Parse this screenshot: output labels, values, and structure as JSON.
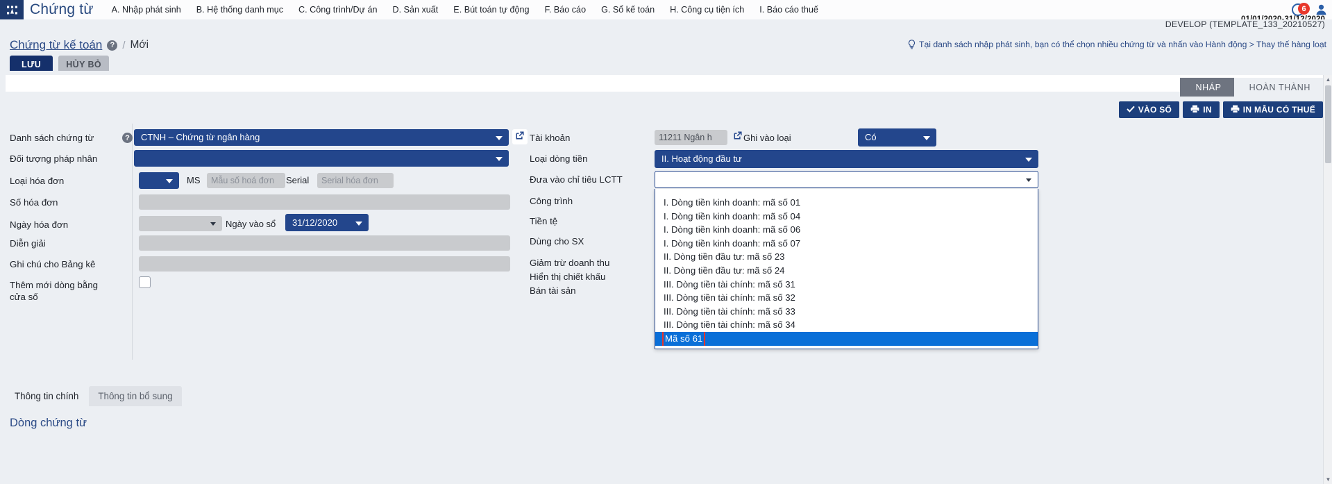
{
  "app": {
    "title": "Chứng từ",
    "logo_icon": "grid-app-icon"
  },
  "menu": [
    {
      "label": "A. Nhập phát sinh"
    },
    {
      "label": "B. Hệ thống danh mục"
    },
    {
      "label": "C. Công trình/Dự án"
    },
    {
      "label": "D. Sản xuất"
    },
    {
      "label": "E. Bút toán tự động"
    },
    {
      "label": "F. Báo cáo"
    },
    {
      "label": "G. Sổ kế toán"
    },
    {
      "label": "H. Công cụ tiện ích"
    },
    {
      "label": "I. Báo cáo thuế"
    }
  ],
  "topbar_right": {
    "notification_count": "6",
    "notification_icon": "bell-icon",
    "user_icon": "user-avatar-icon",
    "date_range": "01/01/2020-31/12/2020",
    "develop_label": "DEVELOP (TEMPLATE_133_20210527)"
  },
  "breadcrumb": {
    "link": "Chứng từ kế toán",
    "help_icon": "question-mark-icon",
    "separator": "/",
    "current": "Mới"
  },
  "tip": {
    "icon": "lightbulb-icon",
    "text": "Tại danh sách nhập phát sinh, bạn có thể chọn nhiều chứng từ và nhấn vào Hành động > Thay thế hàng loạt"
  },
  "actions": {
    "save_label": "LƯU",
    "cancel_label": "HỦY BỎ"
  },
  "status_tabs": [
    {
      "label": "NHÁP",
      "state": "active"
    },
    {
      "label": "HOÀN THÀNH",
      "state": "inactive"
    }
  ],
  "toolbar": [
    {
      "label": "VÀO SỔ",
      "icon": "check-icon"
    },
    {
      "label": "IN",
      "icon": "printer-icon"
    },
    {
      "label": "IN MẪU CÓ THUẾ",
      "icon": "printer-icon"
    }
  ],
  "form": {
    "left_column": [
      {
        "label": "Danh sách chứng từ",
        "help_icon": "question-mark-icon"
      },
      {
        "label": "Đối tượng pháp nhân"
      },
      {
        "label": "Loại hóa đơn"
      },
      {
        "label": "Số hóa đơn"
      },
      {
        "label": "Ngày hóa đơn"
      },
      {
        "label": "Diễn giải"
      },
      {
        "label": "Ghi chú cho Bảng kê"
      },
      {
        "label": "Thêm mới dòng bằng cửa số"
      }
    ],
    "voucher_list_value": "CTNH – Chứng từ ngân hàng",
    "external_link_icon": "external-link-icon",
    "legal_entity_value": "",
    "invoice_type_value": "",
    "ms_label": "MS",
    "invoice_template_placeholder": "Mẫu số hoá đơn",
    "serial_label": "Serial",
    "serial_placeholder": "Serial hóa đơn",
    "invoice_number_value": "",
    "invoice_date_value": "",
    "entry_date_label": "Ngày vào sổ",
    "entry_date_value": "31/12/2020",
    "description_value": "",
    "note_value": "",
    "new_row_checkbox_checked": false,
    "middle_column": [
      {
        "label": "Tài khoản"
      },
      {
        "label": "Loại dòng tiền"
      },
      {
        "label": "Đưa vào chỉ tiêu LCTT"
      },
      {
        "label": "Công trình"
      },
      {
        "label": "Tiền tệ"
      },
      {
        "label": "Dùng cho SX"
      },
      {
        "label": "Giảm trừ doanh thu"
      },
      {
        "label": "Hiển thị chiết khấu"
      },
      {
        "label": "Bán tài sản"
      }
    ],
    "account_value": "11211 Ngân h",
    "account_link_icon": "external-link-icon",
    "record_as_label": "Ghi vào loại",
    "record_as_value": "Có",
    "cashflow_type_value": "II. Hoạt động đầu tư",
    "lctt_value": ""
  },
  "dropdown": {
    "open": true,
    "options": [
      {
        "label": "I. Dòng tiền kinh doanh: mã số 01",
        "selected": false
      },
      {
        "label": "I. Dòng tiền kinh doanh: mã số 04",
        "selected": false
      },
      {
        "label": "I. Dòng tiền kinh doanh: mã số 06",
        "selected": false
      },
      {
        "label": "I. Dòng tiền kinh doanh: mã số 07",
        "selected": false
      },
      {
        "label": "II. Dòng tiền đầu tư: mã số 23",
        "selected": false
      },
      {
        "label": "II. Dòng tiền đầu tư: mã số 24",
        "selected": false
      },
      {
        "label": "III. Dòng tiền tài chính: mã số 31",
        "selected": false
      },
      {
        "label": "III. Dòng tiền tài chính: mã số 32",
        "selected": false
      },
      {
        "label": "III. Dòng tiền tài chính: mã số 33",
        "selected": false
      },
      {
        "label": "III. Dòng tiền tài chính: mã số 34",
        "selected": false
      },
      {
        "label": "Mã số 61",
        "selected": true
      }
    ]
  },
  "bottom": {
    "tabs": [
      {
        "label": "Thông tin chính",
        "active": true
      },
      {
        "label": "Thông tin bổ sung",
        "active": false
      }
    ],
    "section_title": "Dòng chứng từ"
  },
  "colors": {
    "brand_blue": "#23468c",
    "accent_blue": "#2b4a86",
    "selection_blue": "#0a6fd8",
    "highlight_red": "#e8352b",
    "page_bg": "#eceff3"
  }
}
